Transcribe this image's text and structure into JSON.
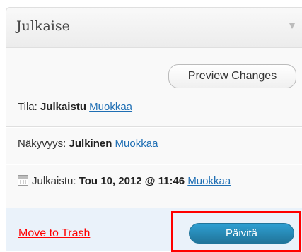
{
  "box": {
    "title": "Julkaise"
  },
  "actions": {
    "preview_label": "Preview Changes"
  },
  "status": {
    "label": "Tila:",
    "value": "Julkaistu",
    "edit_label": "Muokkaa"
  },
  "visibility": {
    "label": "Näkyvyys:",
    "value": "Julkinen",
    "edit_label": "Muokkaa"
  },
  "published": {
    "icon": "calendar-icon",
    "label": "Julkaistu:",
    "value": "Tou 10, 2012 @ 11:46",
    "edit_label": "Muokkaa"
  },
  "footer": {
    "trash_label": "Move to Trash",
    "update_label": "Päivitä",
    "highlight_color": "#ff0000",
    "button_color": "#21759b"
  }
}
